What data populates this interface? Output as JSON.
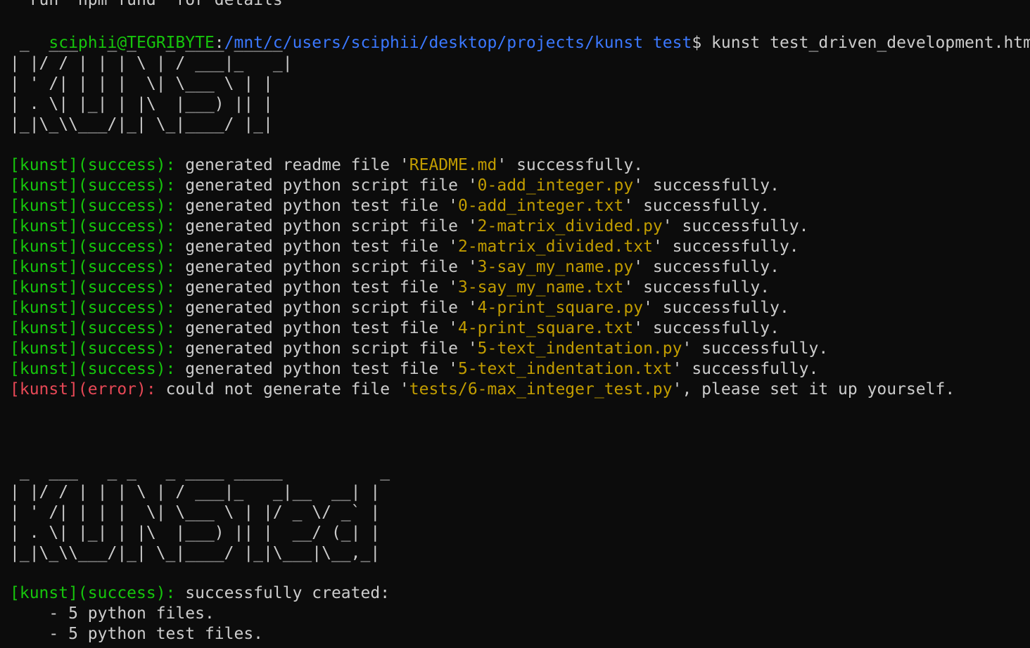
{
  "terminal": {
    "top_cut_line": "  run `npm fund` for details",
    "prompt": {
      "user_host": "sciphii@TEGRIBYTE",
      "colon": ":",
      "path": "/mnt/c/users/sciphii/desktop/projects/kunst test",
      "symbol": "$",
      "command": " kunst test_driven_development.html"
    },
    "banner1": [
      " _  ___   _ _   _ ____ _____",
      "| |/ / | | | \\ | / ___|_   _|",
      "| ' /| | | |  \\| \\___ \\ | |",
      "| . \\| |_| | |\\  |___) || |",
      "|_|\\_\\\\___/|_| \\_|____/ |_|"
    ],
    "messages": [
      {
        "tag": "[kunst](success):",
        "pre": " generated readme file '",
        "file": "README.md",
        "post": "' successfully."
      },
      {
        "tag": "[kunst](success):",
        "pre": " generated python script file '",
        "file": "0-add_integer.py",
        "post": "' successfully."
      },
      {
        "tag": "[kunst](success):",
        "pre": " generated python test file '",
        "file": "0-add_integer.txt",
        "post": "' successfully."
      },
      {
        "tag": "[kunst](success):",
        "pre": " generated python script file '",
        "file": "2-matrix_divided.py",
        "post": "' successfully."
      },
      {
        "tag": "[kunst](success):",
        "pre": " generated python test file '",
        "file": "2-matrix_divided.txt",
        "post": "' successfully."
      },
      {
        "tag": "[kunst](success):",
        "pre": " generated python script file '",
        "file": "3-say_my_name.py",
        "post": "' successfully."
      },
      {
        "tag": "[kunst](success):",
        "pre": " generated python test file '",
        "file": "3-say_my_name.txt",
        "post": "' successfully."
      },
      {
        "tag": "[kunst](success):",
        "pre": " generated python script file '",
        "file": "4-print_square.py",
        "post": "' successfully."
      },
      {
        "tag": "[kunst](success):",
        "pre": " generated python test file '",
        "file": "4-print_square.txt",
        "post": "' successfully."
      },
      {
        "tag": "[kunst](success):",
        "pre": " generated python script file '",
        "file": "5-text_indentation.py",
        "post": "' successfully."
      },
      {
        "tag": "[kunst](success):",
        "pre": " generated python test file '",
        "file": "5-text_indentation.txt",
        "post": "' successfully."
      }
    ],
    "error_message": {
      "tag": "[kunst](error):",
      "pre": " could not generate file '",
      "file": "tests/6-max_integer_test.py",
      "post": "', please set it up yourself."
    },
    "banner2": [
      " _  ___   _ _   _ ____ _____          _",
      "| |/ / | | | \\ | / ___|_   _|__  __| |",
      "| ' /| | | |  \\| \\___ \\ | |/ _ \\/ _` |",
      "| . \\| |_| | |\\  |___) || |  __/ (_| |",
      "|_|\\_\\\\___/|_| \\_|____/ |_|\\___|\\__,_|"
    ],
    "summary": {
      "tag": "[kunst](success):",
      "text": " successfully created:",
      "items": [
        "    - 5 python files.",
        "    - 5 python test files."
      ]
    },
    "colors": {
      "background": "#0c0c0c",
      "foreground": "#cccccc",
      "success": "#16c60c",
      "path": "#3b78ff",
      "filename": "#c19c00",
      "error": "#e74856"
    }
  }
}
